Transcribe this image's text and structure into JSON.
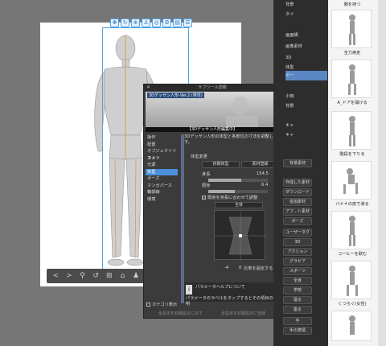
{
  "toolbar_icons": [
    "move-icon",
    "rotate-icon",
    "zoom-icon",
    "pose-icon",
    "camera-icon",
    "settings-icon",
    "save-icon",
    "menu-icon"
  ],
  "bottom_bar": [
    "<",
    ">",
    "⚲",
    "↺",
    "⊞",
    "⌂",
    "♟",
    "▸"
  ],
  "panel": {
    "title": "サブツール詳細",
    "preview_label": "3Dデッサン人形-Ver.2 (男性)",
    "edit_banner": "【3Dデッサン人形編集中】",
    "description": "3Dデッサン人形の体型と各部位の寸法を調整します。",
    "categories": [
      "操作",
      "配置",
      "オブジェクトリスト",
      "カメラ",
      "光源",
      "体型",
      "ポーズ",
      "マンガパース",
      "輪郭線",
      "環境"
    ],
    "selected_category": "体型",
    "section_title": "体型変更",
    "buttons": {
      "initial": "初期体型",
      "register": "素材登録"
    },
    "sliders": [
      {
        "label": "身長",
        "value": "154.5",
        "fill": 0.55
      },
      {
        "label": "頭身",
        "value": "6.4",
        "fill": 0.45
      }
    ],
    "checkbox": "頭身を身長に合わせて調整",
    "body_select": "全体",
    "graph_values": {
      "left": "-4",
      "right": "0",
      "ratio": "比率を固定する"
    },
    "help_title": "パラメータヘルプについて",
    "help_text": "パラメータのラベルをタップするとその項目の説明",
    "category_list": "カテゴリ表示",
    "footer_left": "全設定を初期設定に戻す",
    "footer_right": "全設定を初期設定に登録"
  },
  "dock": {
    "items": [
      "背景",
      "タイ",
      "画面構",
      "画像素材",
      "3D",
      "体型",
      "ポー",
      "小物",
      "背景",
      "キャ",
      "キャ"
    ],
    "buttons": [
      "背景素材",
      "作成した素材",
      "ダウンロード",
      "追加素材",
      "アフ...ト素材",
      "ポーズ",
      "ユーザータグ",
      "3D",
      "アクション",
      "グラビア",
      "スポーツ",
      "全身",
      "学校",
      "寝る",
      "座る",
      "手",
      "手の表情"
    ]
  },
  "poses": [
    "腕を持つ",
    "全力疾走",
    "A_ドアを開ける",
    "階段を下りる",
    "バナナの皮で滑る",
    "コーヒーを飲む",
    "くつろぐ(女性)"
  ]
}
